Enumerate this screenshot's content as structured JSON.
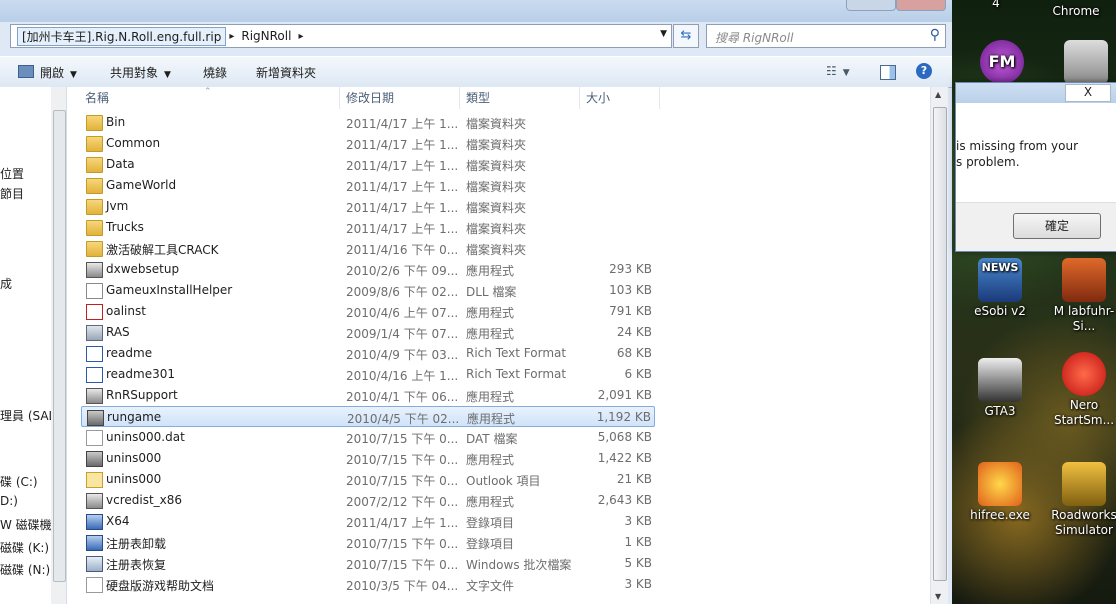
{
  "address": {
    "segments": [
      "[加州卡车王].Rig.N.Roll.eng.full.rip",
      "RigNRoll"
    ]
  },
  "search": {
    "placeholder": "搜尋 RigNRoll"
  },
  "toolbar": {
    "organize": "開啟",
    "share": "共用對象",
    "burn": "燒錄",
    "new_folder": "新增資料夾"
  },
  "columns": {
    "name": "名稱",
    "date": "修改日期",
    "type": "類型",
    "size": "大小"
  },
  "nav": {
    "items": [
      "位置",
      "節目",
      "成",
      "理員 (SAL",
      "碟 (C:)",
      "D:)",
      "W 磁碟機",
      "磁碟 (K:)",
      "磁碟 (N:)"
    ]
  },
  "files": [
    {
      "name": "Bin",
      "date": "2011/4/17 上午 1...",
      "type": "檔案資料夾",
      "size": "",
      "icon": "folder"
    },
    {
      "name": "Common",
      "date": "2011/4/17 上午 1...",
      "type": "檔案資料夾",
      "size": "",
      "icon": "folder"
    },
    {
      "name": "Data",
      "date": "2011/4/17 上午 1...",
      "type": "檔案資料夾",
      "size": "",
      "icon": "folder"
    },
    {
      "name": "GameWorld",
      "date": "2011/4/17 上午 1...",
      "type": "檔案資料夾",
      "size": "",
      "icon": "folder"
    },
    {
      "name": "Jvm",
      "date": "2011/4/17 上午 1...",
      "type": "檔案資料夾",
      "size": "",
      "icon": "folder"
    },
    {
      "name": "Trucks",
      "date": "2011/4/17 上午 1...",
      "type": "檔案資料夾",
      "size": "",
      "icon": "folder"
    },
    {
      "name": "激活破解工具CRACK",
      "date": "2011/4/16 下午 0...",
      "type": "檔案資料夾",
      "size": "",
      "icon": "folder"
    },
    {
      "name": "dxwebsetup",
      "date": "2010/2/6 下午 09...",
      "type": "應用程式",
      "size": "293 KB",
      "icon": "setup"
    },
    {
      "name": "GameuxInstallHelper",
      "date": "2009/8/6 下午 02...",
      "type": "DLL 檔案",
      "size": "103 KB",
      "icon": "dll"
    },
    {
      "name": "oalinst",
      "date": "2010/4/6 上午 07...",
      "type": "應用程式",
      "size": "791 KB",
      "icon": "oal"
    },
    {
      "name": "RAS",
      "date": "2009/1/4 下午 07...",
      "type": "應用程式",
      "size": "24 KB",
      "icon": "app"
    },
    {
      "name": "readme",
      "date": "2010/4/9 下午 03...",
      "type": "Rich Text Format",
      "size": "68 KB",
      "icon": "rtf"
    },
    {
      "name": "readme301",
      "date": "2010/4/16 上午 1...",
      "type": "Rich Text Format",
      "size": "6 KB",
      "icon": "rtf"
    },
    {
      "name": "RnRSupport",
      "date": "2010/4/1 下午 06...",
      "type": "應用程式",
      "size": "2,091 KB",
      "icon": "setup"
    },
    {
      "name": "rungame",
      "date": "2010/4/5 下午 02...",
      "type": "應用程式",
      "size": "1,192 KB",
      "icon": "game"
    },
    {
      "name": "unins000.dat",
      "date": "2010/7/15 下午 0...",
      "type": "DAT 檔案",
      "size": "5,068 KB",
      "icon": "file"
    },
    {
      "name": "unins000",
      "date": "2010/7/15 下午 0...",
      "type": "應用程式",
      "size": "1,422 KB",
      "icon": "game"
    },
    {
      "name": "unins000",
      "date": "2010/7/15 下午 0...",
      "type": "Outlook 項目",
      "size": "21 KB",
      "icon": "mail"
    },
    {
      "name": "vcredist_x86",
      "date": "2007/2/12 下午 0...",
      "type": "應用程式",
      "size": "2,643 KB",
      "icon": "setup"
    },
    {
      "name": "X64",
      "date": "2011/4/17 上午 1...",
      "type": "登錄項目",
      "size": "3 KB",
      "icon": "reg"
    },
    {
      "name": "注册表卸载",
      "date": "2010/7/15 下午 0...",
      "type": "登錄項目",
      "size": "1 KB",
      "icon": "reg"
    },
    {
      "name": "注册表恢复",
      "date": "2010/7/15 下午 0...",
      "type": "Windows 批次檔案",
      "size": "5 KB",
      "icon": "bat"
    },
    {
      "name": "硬盘版游戏帮助文档",
      "date": "2010/3/5 下午 04...",
      "type": "文字文件",
      "size": "3 KB",
      "icon": "txt"
    }
  ],
  "selected_index": 14,
  "dialog": {
    "line1": "is missing from your",
    "line2": "s problem.",
    "ok": "確定",
    "close": "X"
  },
  "desktop": {
    "top_labels": [
      "4",
      "Chrome"
    ],
    "icons": [
      "eSobi v2",
      "M labfuhr-Si...",
      "GTA3",
      "Nero StartSm...",
      "hifree.exe",
      "Roadworks Simulator"
    ]
  }
}
